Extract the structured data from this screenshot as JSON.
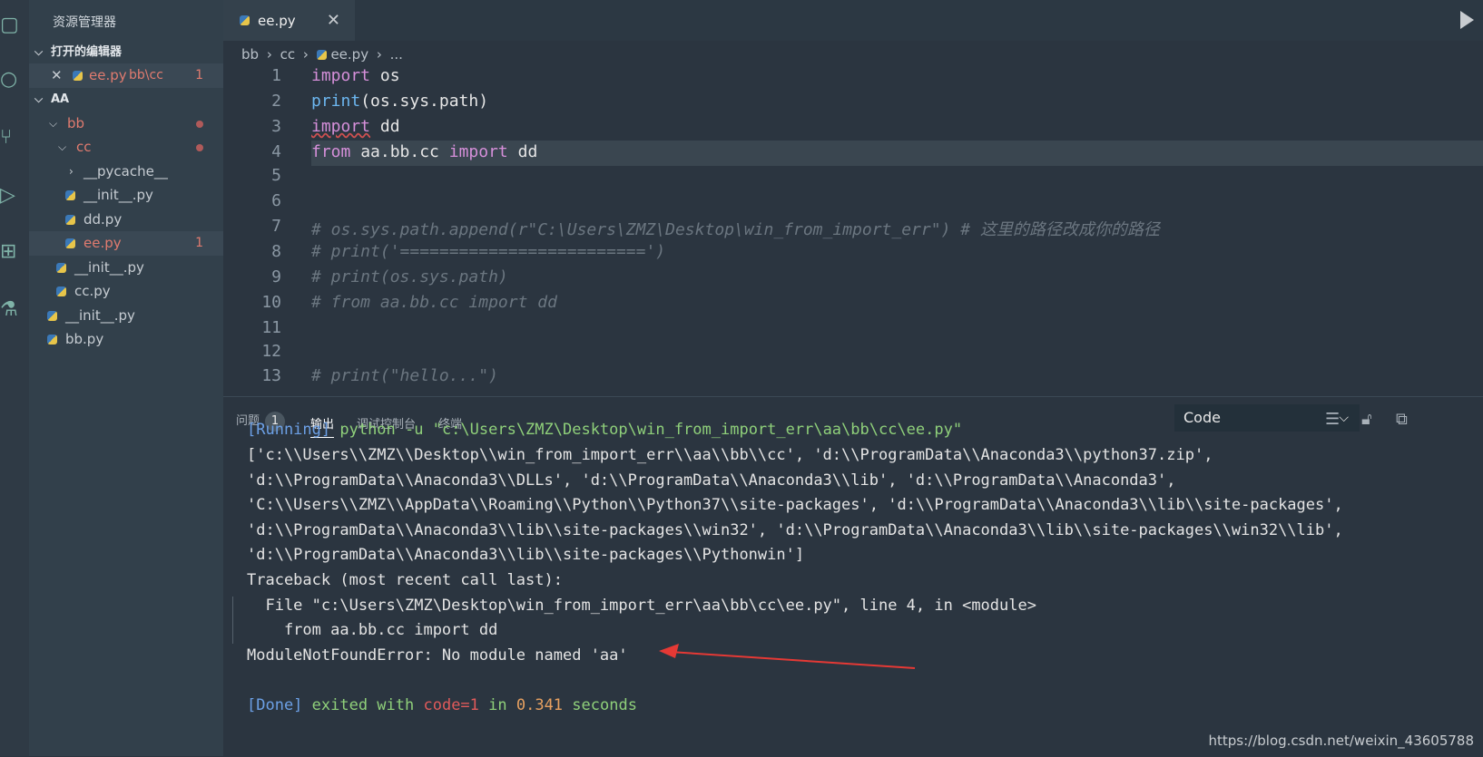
{
  "sidebar": {
    "title": "资源管理器",
    "open_editors_label": "打开的编辑器",
    "open_file": {
      "name": "ee.py",
      "path": "bb\\cc",
      "count": "1"
    },
    "root_label": "AA",
    "tree": [
      {
        "label": "bb",
        "depth": 1
      },
      {
        "label": "cc",
        "depth": 2
      },
      {
        "label": "__pycache__",
        "depth": 3
      },
      {
        "label": "__init__.py",
        "depth": 3
      },
      {
        "label": "dd.py",
        "depth": 3
      },
      {
        "label": "ee.py",
        "depth": 3,
        "count": "1"
      },
      {
        "label": "__init__.py",
        "depth": 2
      },
      {
        "label": "cc.py",
        "depth": 2
      },
      {
        "label": "__init__.py",
        "depth": 1
      },
      {
        "label": "bb.py",
        "depth": 1
      }
    ]
  },
  "tab": {
    "label": "ee.py"
  },
  "breadcrumb": {
    "bb": "bb",
    "cc": "cc",
    "file": "ee.py",
    "more": "..."
  },
  "editor": {
    "line_numbers": [
      "1",
      "2",
      "3",
      "4",
      "5",
      "6",
      "7",
      "8",
      "9",
      "10",
      "11",
      "12",
      "13"
    ],
    "lines": [
      "import os",
      "print(os.sys.path)",
      "import dd",
      "from aa.bb.cc import dd",
      "",
      "",
      "# os.sys.path.append(r\"C:\\Users\\ZMZ\\Desktop\\win_from_import_err\") # 这里的路径改成你的路径",
      "# print('=========================')",
      "# print(os.sys.path)",
      "# from aa.bb.cc import dd",
      "",
      "",
      "# print(\"hello...\")"
    ]
  },
  "panel": {
    "tabs": {
      "problems": "问题",
      "problems_count": "1",
      "output": "输出",
      "debug": "调试控制台",
      "terminal": "终端"
    },
    "select_value": "Code",
    "output": {
      "running_tag": "[Running]",
      "running_cmd": " python -u \"c:\\Users\\ZMZ\\Desktop\\win_from_import_err\\aa\\bb\\cc\\ee.py\"",
      "path_lines": [
        "['c:\\\\Users\\\\ZMZ\\\\Desktop\\\\win_from_import_err\\\\aa\\\\bb\\\\cc', 'd:\\\\ProgramData\\\\Anaconda3\\\\python37.zip',",
        "'d:\\\\ProgramData\\\\Anaconda3\\\\DLLs', 'd:\\\\ProgramData\\\\Anaconda3\\\\lib', 'd:\\\\ProgramData\\\\Anaconda3',",
        "'C:\\\\Users\\\\ZMZ\\\\AppData\\\\Roaming\\\\Python\\\\Python37\\\\site-packages', 'd:\\\\ProgramData\\\\Anaconda3\\\\lib\\\\site-packages',",
        "'d:\\\\ProgramData\\\\Anaconda3\\\\lib\\\\site-packages\\\\win32', 'd:\\\\ProgramData\\\\Anaconda3\\\\lib\\\\site-packages\\\\win32\\\\lib',",
        "'d:\\\\ProgramData\\\\Anaconda3\\\\lib\\\\site-packages\\\\Pythonwin']"
      ],
      "traceback": "Traceback (most recent call last):",
      "file_line": "  File \"c:\\Users\\ZMZ\\Desktop\\win_from_import_err\\aa\\bb\\cc\\ee.py\", line 4, in <module>",
      "code_line": "    from aa.bb.cc import dd",
      "error": "ModuleNotFoundError: No module named 'aa'",
      "done_tag": "[Done]",
      "done_exited": " exited with ",
      "done_code": "code=1",
      "done_in": " in ",
      "done_time": "0.341",
      "done_seconds": " seconds"
    }
  },
  "watermark": "https://blog.csdn.net/weixin_43605788",
  "colors": {
    "accent_red": "#e05a5a",
    "keyword": "#d58fd9",
    "function": "#6cb6ef"
  }
}
